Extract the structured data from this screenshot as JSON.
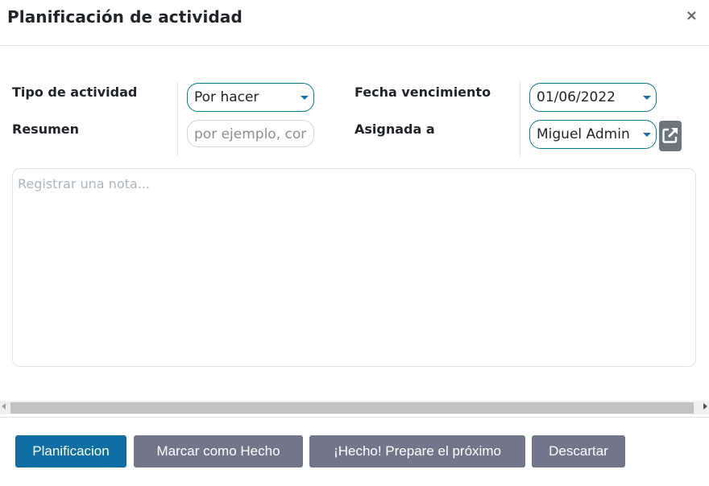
{
  "dialog": {
    "title": "Planificación de actividad",
    "close": "×"
  },
  "form": {
    "activity_type": {
      "label": "Tipo de actividad",
      "value": "Por hacer"
    },
    "summary": {
      "label": "Resumen",
      "placeholder": "por ejemplo, cor"
    },
    "due_date": {
      "label": "Fecha vencimiento",
      "value": "01/06/2022"
    },
    "assigned_to": {
      "label": "Asignada a",
      "value": "Miguel Admin"
    }
  },
  "note": {
    "placeholder": "Registrar una nota..."
  },
  "footer": {
    "schedule": "Planificacion",
    "mark_done": "Marcar como Hecho",
    "done_next": "¡Hecho! Prepare el próximo",
    "discard": "Descartar"
  },
  "colors": {
    "primary": "#0f6fa5",
    "secondary": "#71768b",
    "accent": "#017e84"
  }
}
